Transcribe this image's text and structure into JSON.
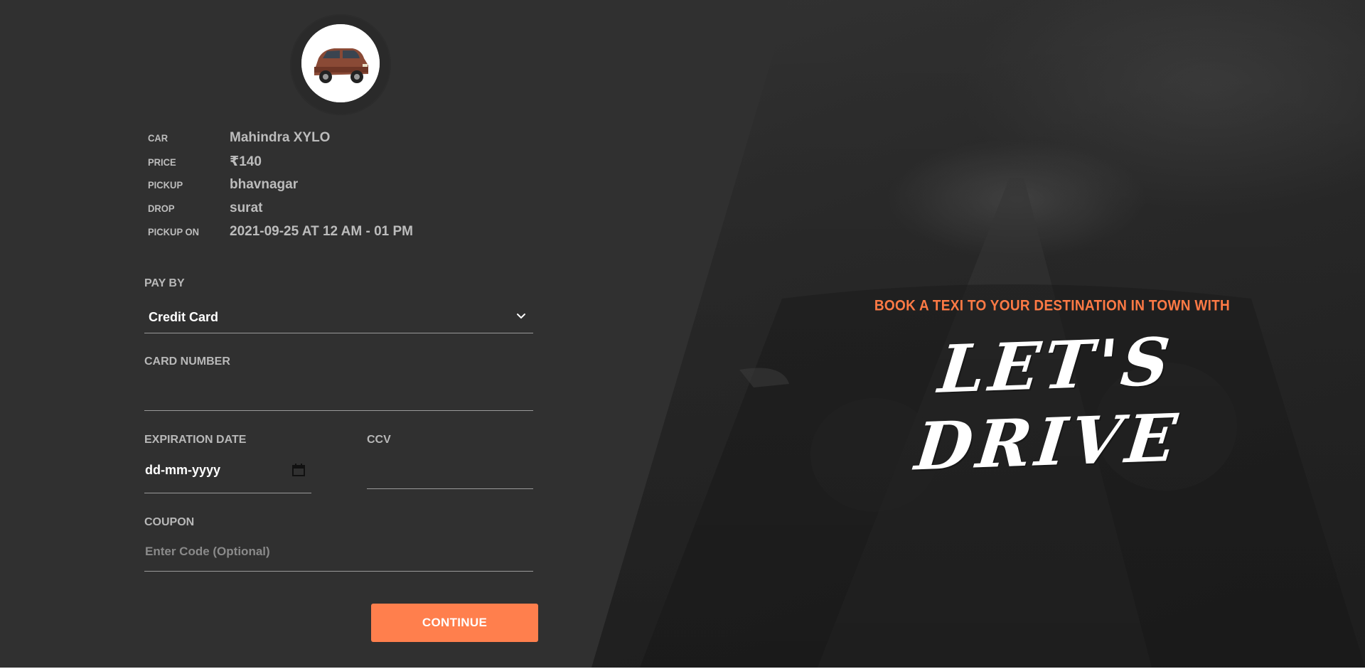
{
  "hero": {
    "tagline": "BOOK A TEXI TO YOUR DESTINATION IN TOWN WITH",
    "brand": "LET'S DRIVE",
    "accent_color": "#ff7a45"
  },
  "booking": {
    "car_image": "car-photo",
    "details": [
      {
        "label": "CAR",
        "value": "Mahindra XYLO"
      },
      {
        "label": "PRICE",
        "value": "₹140"
      },
      {
        "label": "PICKUP",
        "value": "bhavnagar"
      },
      {
        "label": "DROP",
        "value": "surat"
      },
      {
        "label": "PICKUP ON",
        "value": "2021-09-25 AT 12 AM - 01 PM"
      }
    ]
  },
  "form": {
    "pay_by_label": "PAY BY",
    "pay_by_value": "Credit Card",
    "card_number_label": "CARD NUMBER",
    "card_number_value": "",
    "expiration_label": "EXPIRATION DATE",
    "expiration_placeholder": "dd-mm-yyyy",
    "ccv_label": "CCV",
    "ccv_value": "",
    "coupon_label": "COUPON",
    "coupon_placeholder": "Enter Code (Optional)",
    "continue_label": "CONTINUE",
    "button_color": "#ff7f4d"
  }
}
